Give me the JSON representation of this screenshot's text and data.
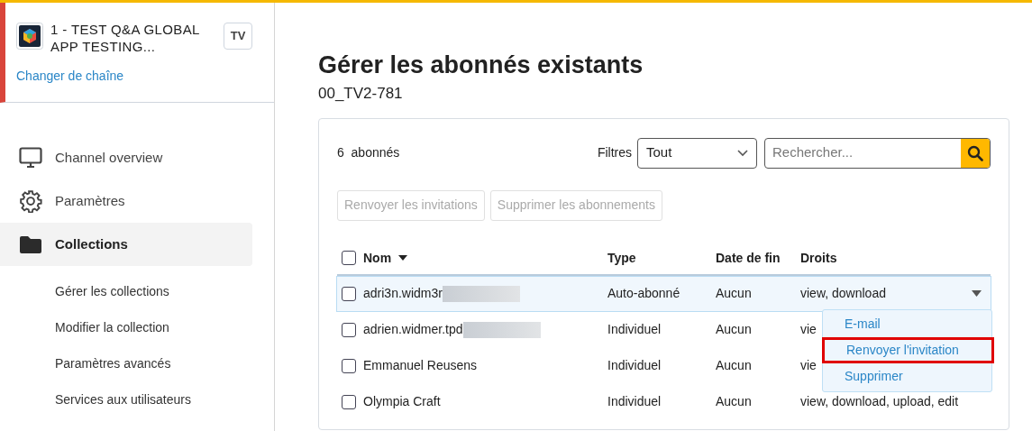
{
  "channel": {
    "name": "1 - TEST Q&A GLOBAL APP TESTING...",
    "badge": "TV",
    "change_link": "Changer de chaîne"
  },
  "sidebar": {
    "items": [
      {
        "label": "Channel overview",
        "selected": false
      },
      {
        "label": "Paramètres",
        "selected": false
      },
      {
        "label": "Collections",
        "selected": true,
        "children": [
          {
            "label": "Gérer les collections"
          },
          {
            "label": "Modifier la collection"
          },
          {
            "label": "Paramètres avancés"
          },
          {
            "label": "Services aux utilisateurs"
          }
        ]
      }
    ]
  },
  "page": {
    "title": "Gérer les abonnés existants",
    "subtitle": "00_TV2-781"
  },
  "toolbar": {
    "count": "6",
    "count_label": "abonnés",
    "filter_label": "Filtres",
    "filter_value": "Tout",
    "search_placeholder": "Rechercher..."
  },
  "actions": [
    {
      "label": "Renvoyer les invitations",
      "disabled": true
    },
    {
      "label": "Supprimer les abonnements",
      "disabled": true
    }
  ],
  "table": {
    "select_all_checked": false,
    "columns": [
      "Nom",
      "Type",
      "Date de fin",
      "Droits"
    ],
    "rows": [
      {
        "name": "adri3n.widm3r",
        "redacted": true,
        "type": "Auto-abonné",
        "end": "Aucun",
        "rights": "view, download",
        "checked": false,
        "highlighted": true,
        "menu_open": true
      },
      {
        "name": "adrien.widmer.tpd",
        "redacted": true,
        "type": "Individuel",
        "end": "Aucun",
        "rights": "vie",
        "checked": false,
        "highlighted": false,
        "menu_open": false
      },
      {
        "name": "Emmanuel Reusens",
        "redacted": false,
        "type": "Individuel",
        "end": "Aucun",
        "rights": "vie",
        "checked": false,
        "highlighted": false,
        "menu_open": false
      },
      {
        "name": "Olympia Craft",
        "redacted": false,
        "type": "Individuel",
        "end": "Aucun",
        "rights": "view, download, upload, edit",
        "checked": false,
        "highlighted": false,
        "menu_open": false
      }
    ]
  },
  "row_menu": [
    {
      "label": "E-mail",
      "highlighted": false
    },
    {
      "label": "Renvoyer l'invitation",
      "highlighted": true
    },
    {
      "label": "Supprimer",
      "highlighted": false
    }
  ]
}
